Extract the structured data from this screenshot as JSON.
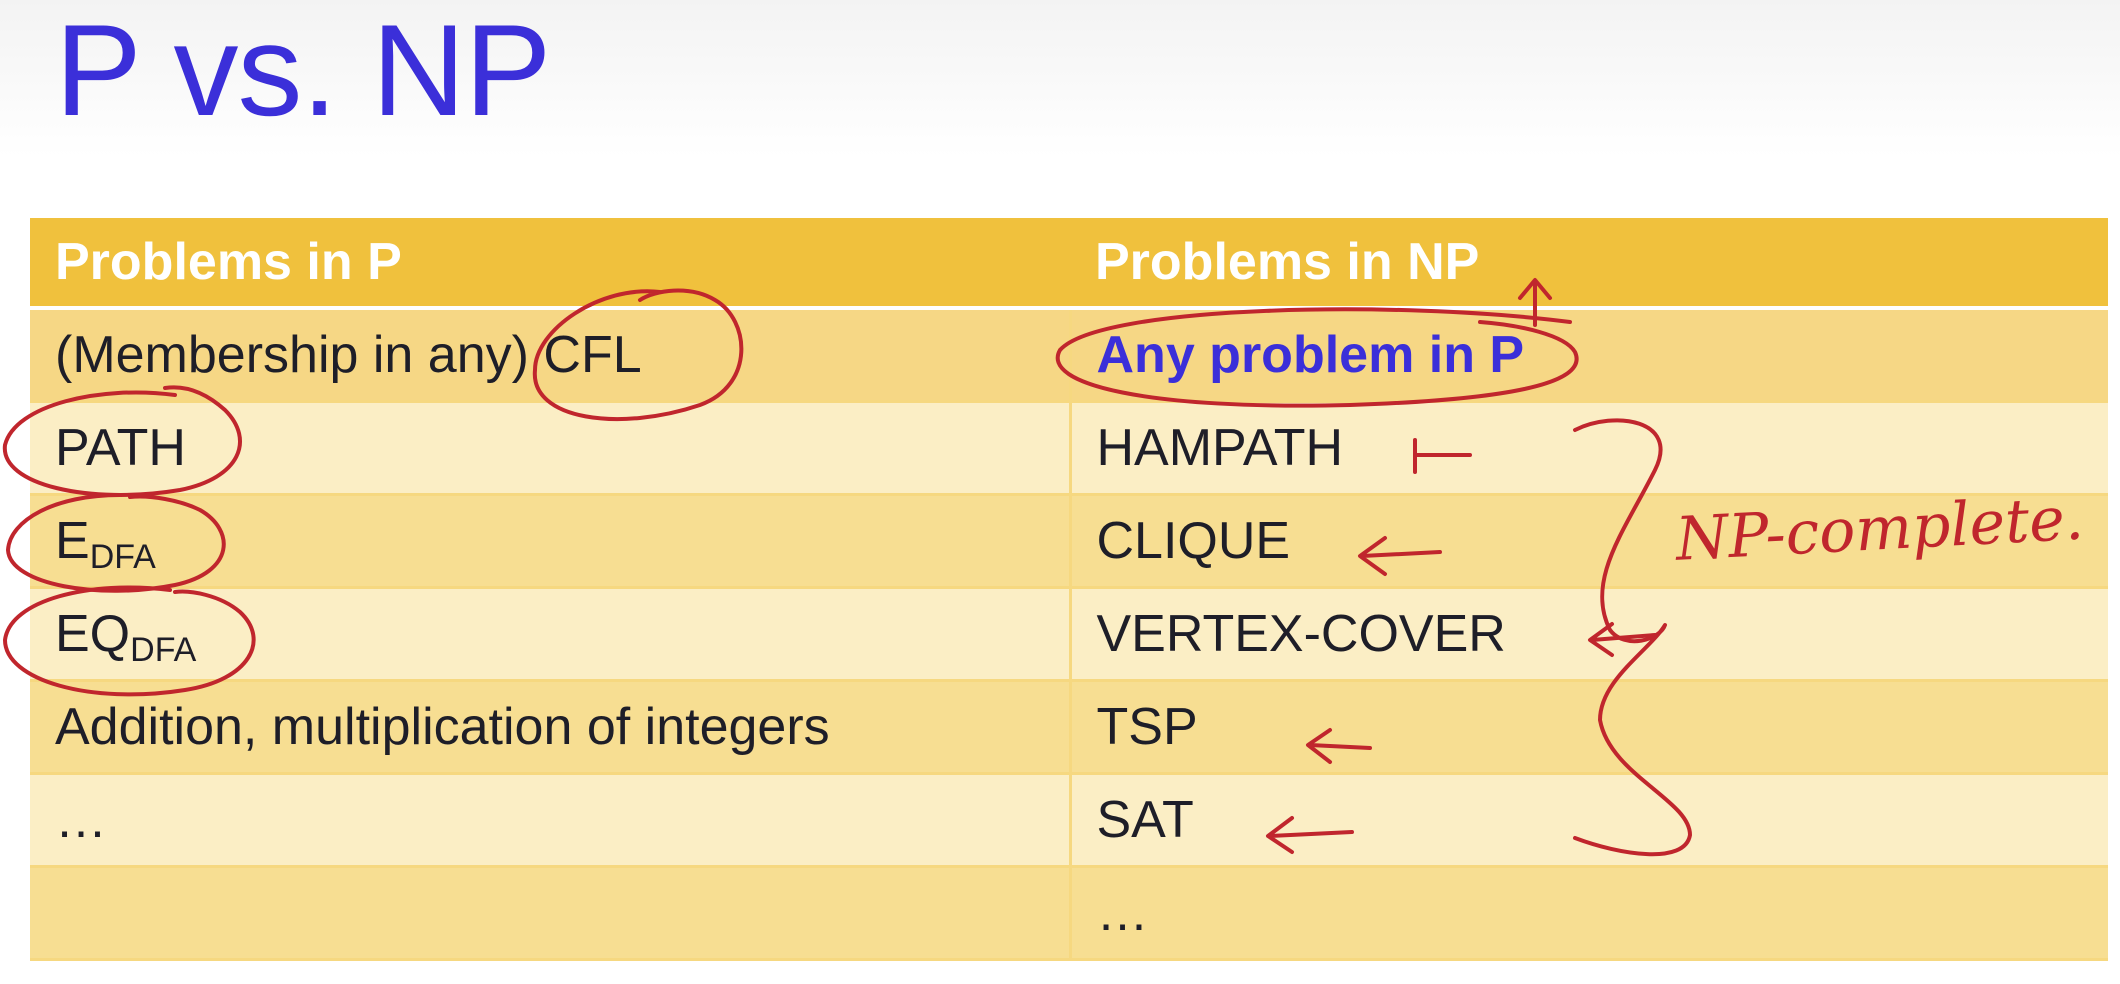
{
  "slide": {
    "title": "P vs. NP",
    "headers": {
      "p": "Problems in P",
      "np": "Problems in NP"
    },
    "rows": [
      {
        "p": "(Membership in any) CFL",
        "np": "Any problem in P"
      },
      {
        "p": "PATH",
        "np": "HAMPATH"
      },
      {
        "p_main": "E",
        "p_sub": "DFA",
        "np": "CLIQUE"
      },
      {
        "p_main": "EQ",
        "p_sub": "DFA",
        "np": "VERTEX-COVER"
      },
      {
        "p": "Addition, multiplication of integers",
        "np": "TSP"
      },
      {
        "p": "…",
        "np": "SAT"
      },
      {
        "p": "",
        "np": "…"
      }
    ],
    "annotation": "NP-complete.",
    "colors": {
      "title": "#3b2fd9",
      "header_bg": "#f0c13d",
      "ink": "#c0262d"
    }
  }
}
